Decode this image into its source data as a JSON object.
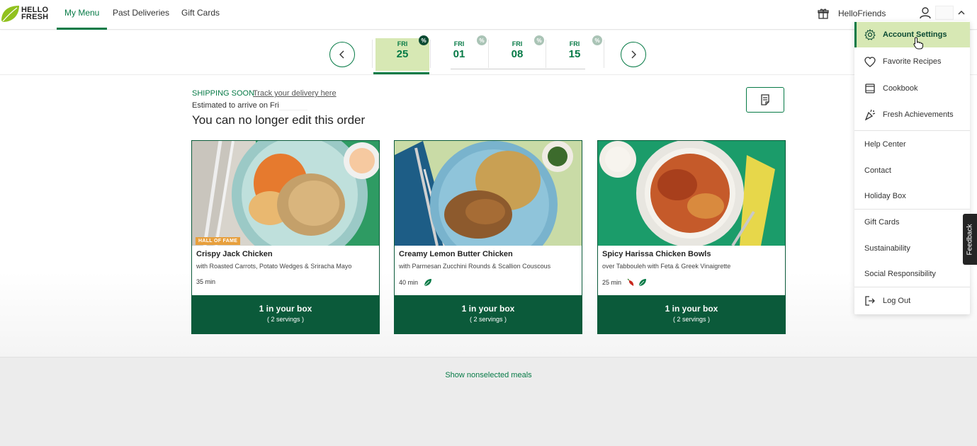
{
  "brand": {
    "line1": "HELLO",
    "line2": "FRESH",
    "color": "#067a46",
    "leaf_color": "#91c11e"
  },
  "nav": {
    "tabs": [
      {
        "label": "My Menu",
        "active": true
      },
      {
        "label": "Past Deliveries",
        "active": false
      },
      {
        "label": "Gift Cards",
        "active": false
      }
    ],
    "friends_label": "HelloFriends"
  },
  "weeks": [
    {
      "dow": "FRI",
      "day": "25",
      "selected": true,
      "badge": "%"
    },
    {
      "dow": "FRI",
      "day": "01",
      "selected": false,
      "badge": "%"
    },
    {
      "dow": "FRI",
      "day": "08",
      "selected": false,
      "badge": "%"
    },
    {
      "dow": "FRI",
      "day": "15",
      "selected": false,
      "badge": "%"
    }
  ],
  "order": {
    "status": "SHIPPING SOON",
    "track_link": "Track your delivery here",
    "arrive_text": "Estimated to arrive on Fri",
    "headline": "You can no longer edit this order"
  },
  "meals": [
    {
      "badge": "HALL OF FAME",
      "title": "Crispy Jack Chicken",
      "subtitle": "with Roasted Carrots, Potato Wedges & Sriracha Mayo",
      "time": "35 min",
      "tags": [],
      "qty": "1 in your box",
      "servings": "( 2 servings )"
    },
    {
      "badge": "",
      "title": "Creamy Lemon Butter Chicken",
      "subtitle": "with Parmesan Zucchini Rounds & Scallion Couscous",
      "time": "40 min",
      "tags": [
        "veggie-leaf"
      ],
      "qty": "1 in your box",
      "servings": "( 2 servings )"
    },
    {
      "badge": "",
      "title": "Spicy Harissa Chicken Bowls",
      "subtitle": "over Tabbouleh with Feta & Greek Vinaigrette",
      "time": "25 min",
      "tags": [
        "spicy-pepper",
        "veggie-leaf"
      ],
      "qty": "1 in your box",
      "servings": "( 2 servings )"
    }
  ],
  "show_nonselected": "Show nonselected meals",
  "menu": {
    "account_settings": "Account Settings",
    "favorite_recipes": "Favorite Recipes",
    "cookbook": "Cookbook",
    "fresh_achievements": "Fresh Achievements",
    "help_center": "Help Center",
    "contact": "Contact",
    "holiday_box": "Holiday Box",
    "gift_cards": "Gift Cards",
    "sustainability": "Sustainability",
    "social_responsibility": "Social Responsibility",
    "log_out": "Log Out"
  },
  "feedback_label": "Feedback"
}
